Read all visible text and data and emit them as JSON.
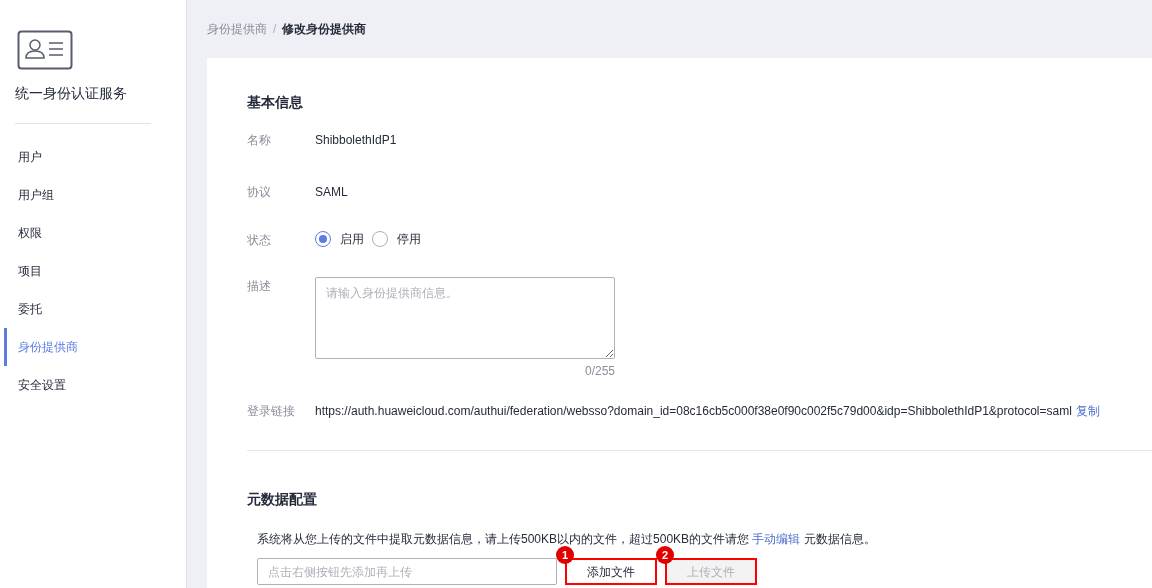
{
  "sidebar": {
    "title": "统一身份认证服务",
    "items": [
      {
        "label": "用户",
        "selected": false
      },
      {
        "label": "用户组",
        "selected": false
      },
      {
        "label": "权限",
        "selected": false
      },
      {
        "label": "项目",
        "selected": false
      },
      {
        "label": "委托",
        "selected": false
      },
      {
        "label": "身份提供商",
        "selected": true
      },
      {
        "label": "安全设置",
        "selected": false
      }
    ]
  },
  "breadcrumb": [
    "身份提供商",
    "修改身份提供商"
  ],
  "breadcrumb_separator": "/",
  "basic_info": {
    "heading": "基本信息",
    "name": {
      "label": "名称",
      "value": "ShibbolethIdP1"
    },
    "protocol": {
      "label": "协议",
      "value": "SAML"
    },
    "status": {
      "label": "状态",
      "options": [
        {
          "label": "启用",
          "selected": true
        },
        {
          "label": "停用",
          "selected": false
        }
      ]
    },
    "description": {
      "label": "描述",
      "placeholder": "请输入身份提供商信息。",
      "counter": "0/255"
    },
    "login_link": {
      "label": "登录链接",
      "url": "https://auth.huaweicloud.com/authui/federation/websso?domain_id=08c16cb5c000f38e0f90c002f5c79d00&idp=ShibbolethIdP1&protocol=saml",
      "copy": "复制"
    }
  },
  "metadata": {
    "heading": "元数据配置",
    "info_before": "系统将从您上传的文件中提取元数据信息，请上传500KB以内的文件，超过500KB的文件请您",
    "info_link": "手动编辑",
    "info_after": "元数据信息。",
    "file_field": {
      "placeholder": "点击右侧按钮先添加再上传"
    },
    "buttons": [
      {
        "label": "添加文件",
        "disabled": false,
        "callout": "1"
      },
      {
        "label": "上传文件",
        "disabled": true,
        "callout": "2"
      }
    ]
  }
}
